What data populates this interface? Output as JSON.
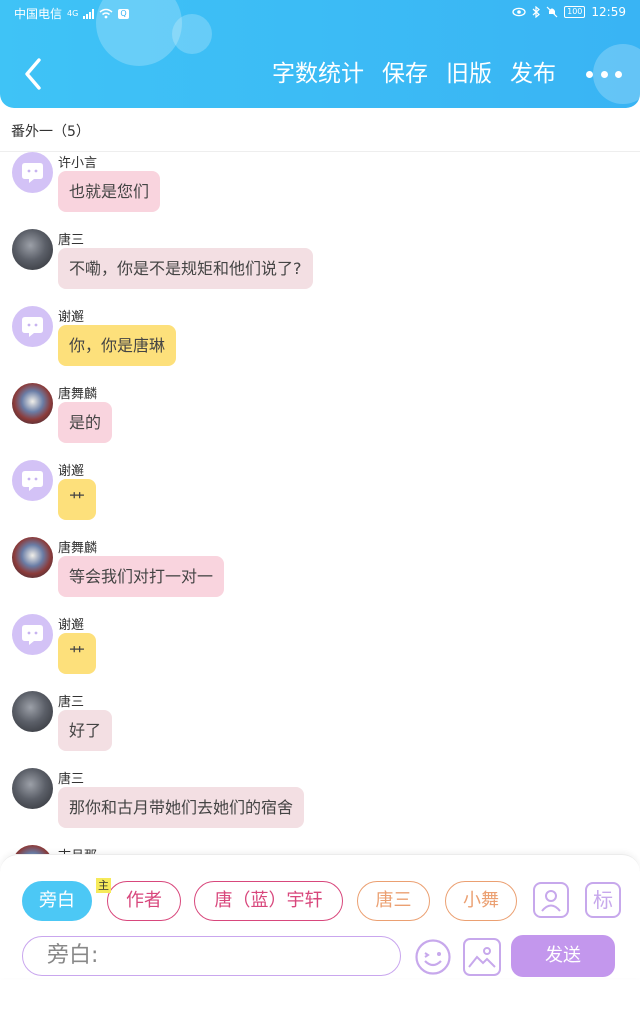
{
  "status_bar": {
    "carrier": "中国电信",
    "network": "4G",
    "battery": "100",
    "time": "12:59"
  },
  "header": {
    "actions": [
      "字数统计",
      "保存",
      "旧版",
      "发布"
    ],
    "back_icon": "chevron-left-icon",
    "more_icon": "more-dots-icon"
  },
  "chapter": {
    "title": "番外一（5）"
  },
  "messages": [
    {
      "name": "许小言",
      "text": "也就是您们",
      "avatar": "bot",
      "bubble_color": "#f9d4de"
    },
    {
      "name": "唐三",
      "text": "不嘞，你是不是规矩和他们说了?",
      "avatar": "dark",
      "bubble_color": "#f3dfe3"
    },
    {
      "name": "谢邂",
      "text": "你，你是唐琳",
      "avatar": "bot",
      "bubble_color": "#fde07b"
    },
    {
      "name": "唐舞麟",
      "text": "是的",
      "avatar": "art",
      "bubble_color": "#f9d4de"
    },
    {
      "name": "谢邂",
      "text": "艹",
      "avatar": "bot",
      "bubble_color": "#fde07b"
    },
    {
      "name": "唐舞麟",
      "text": "等会我们对打一对一",
      "avatar": "art",
      "bubble_color": "#f9d4de"
    },
    {
      "name": "谢邂",
      "text": "艹",
      "avatar": "bot",
      "bubble_color": "#fde07b"
    },
    {
      "name": "唐三",
      "text": "好了",
      "avatar": "dark",
      "bubble_color": "#f3dfe3"
    },
    {
      "name": "唐三",
      "text": "那你和古月带她们去她们的宿舍",
      "avatar": "dark",
      "bubble_color": "#f3dfe3"
    },
    {
      "name": "古月那",
      "text": "",
      "avatar": "art",
      "bubble_color": "#f9d4de"
    }
  ],
  "roles": [
    {
      "label": "旁白",
      "selected": true,
      "color": "#4cc8f5"
    },
    {
      "label": "作者",
      "selected": false,
      "color": "#d8477c"
    },
    {
      "label": "唐（蓝）宇轩",
      "selected": false,
      "color": "#d8477c"
    },
    {
      "label": "唐三",
      "selected": false,
      "color": "#eba072"
    },
    {
      "label": "小舞",
      "selected": false,
      "color": "#eba072"
    }
  ],
  "main_tag": "主",
  "tool_icons": {
    "role_icon": "person-card-icon",
    "mark_label": "标"
  },
  "composer": {
    "placeholder": "旁白:",
    "send_label": "发送",
    "emoji_icon": "emoji-icon",
    "image_icon": "image-icon"
  }
}
